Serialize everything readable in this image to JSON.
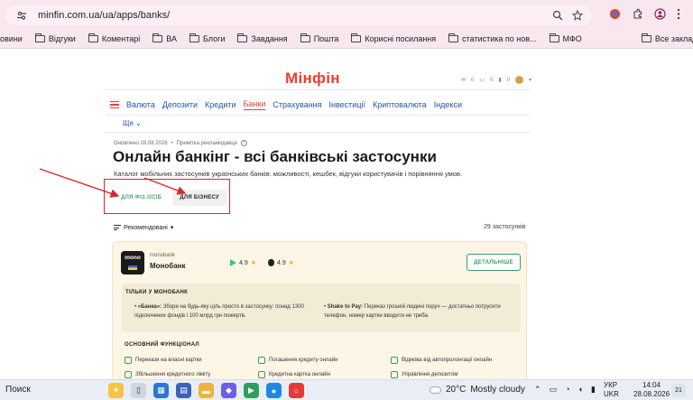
{
  "browser": {
    "url": "minfin.com.ua/ua/apps/banks/",
    "bookmarks": [
      "овини",
      "Відгуки",
      "Коментарі",
      "ВА",
      "Блоги",
      "Завдання",
      "Пошта",
      "Корисні посилання",
      "статистика по нов...",
      "МФО"
    ],
    "all_bookmarks": "Все закладки"
  },
  "site": {
    "logo": "Мінфін",
    "nav": [
      "Валюта",
      "Депозити",
      "Кредити",
      "Банки",
      "Страхування",
      "Інвестиції",
      "Криптовалюта",
      "Індекси"
    ],
    "active_nav": "Банки",
    "more": "Ще",
    "counts": [
      "0",
      "0",
      "0"
    ]
  },
  "page": {
    "updated": "Оновлено 28.08.2026",
    "ad_note": "Примітка рекламодавця",
    "title": "Онлайн банкінг - всі банківські застосунки",
    "subtitle": "Каталог мобільних застосунків українських банків: можливості, кешбек, відгуки користувачів і порівняння умов.",
    "tab_individuals": "ДЛЯ ФІЗ.ОСІБ",
    "tab_business": "ДЛЯ БІЗНЕСУ",
    "sort": "Рекомендовані",
    "count": "29 застосунків"
  },
  "card": {
    "logo_text": "mono",
    "bank_small": "monobank",
    "bank_name": "Монобанк",
    "google_rating": "4.9",
    "apple_rating": "4.9",
    "details": "ДЕТАЛЬНІШЕ",
    "exclusive_title": "ТІЛЬКИ У МОНОБАНК",
    "bullet1_bold": "«Банка»:",
    "bullet1": " Збори на будь-яку ціль просто в застосунку: понад 1300 підключених фондів і 100 млрд грн пожертв.",
    "bullet2_bold": "Shake to Pay:",
    "bullet2": " Переказ грошей людині поруч — достатньо потрусити телефон, номер картки вводити не треба.",
    "features_title": "ОСНОВНИЙ ФУНКЦІОНАЛ",
    "features": [
      "Перекази на власні картки",
      "Погашення кредиту онлайн",
      "Відмова від автопролонгації онлайн",
      "Збільшення кредитного ліміту",
      "Кредитна картка онлайн",
      "Управління депозитом"
    ]
  },
  "taskbar": {
    "search": "Поиск",
    "temperature": "20°C",
    "weather": "Mostly cloudy",
    "lang1": "УКР",
    "lang2": "UKR",
    "time": "14:04",
    "date": "28.08.2026",
    "notifications": "21"
  }
}
